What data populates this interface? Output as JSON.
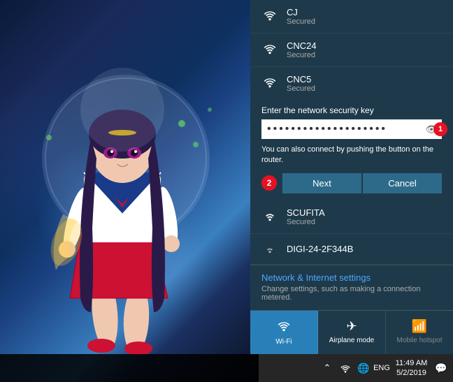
{
  "wallpaper": {
    "description": "Anime sailor character wallpaper"
  },
  "wifi_panel": {
    "networks": [
      {
        "id": "cj",
        "name": "CJ",
        "status": "Secured"
      },
      {
        "id": "cnc24",
        "name": "CNC24",
        "status": "Secured"
      },
      {
        "id": "cnc5",
        "name": "CNC5",
        "status": "Secured"
      }
    ],
    "security_key": {
      "label": "Enter the network security key",
      "placeholder": "••••••••••••••••••••",
      "password_dots": "••••••••••••••••••••",
      "badge": "1"
    },
    "push_button_text": "You can also connect by pushing the button on the router.",
    "badge2": "2",
    "next_label": "Next",
    "cancel_label": "Cancel",
    "after_networks": [
      {
        "id": "scufita",
        "name": "SCUFITA",
        "status": "Secured"
      },
      {
        "id": "digi",
        "name": "DIGI-24-2F344B",
        "status": ""
      }
    ],
    "settings": {
      "title": "Network & Internet settings",
      "description": "Change settings, such as making a connection metered."
    },
    "quick_actions": [
      {
        "id": "wifi",
        "label": "Wi-Fi",
        "icon": "wifi",
        "active": true
      },
      {
        "id": "airplane",
        "label": "Airplane mode",
        "icon": "airplane",
        "active": false
      },
      {
        "id": "mobile",
        "label": "Mobile hotspot",
        "icon": "mobile",
        "active": false,
        "disabled": true
      }
    ]
  },
  "taskbar": {
    "hidden_icons": "^",
    "network_icon": "network",
    "language_icon": "globe",
    "lang": "ENG",
    "time": "11:49 AM",
    "date": "5/2/2019",
    "notification_icon": "comment"
  }
}
